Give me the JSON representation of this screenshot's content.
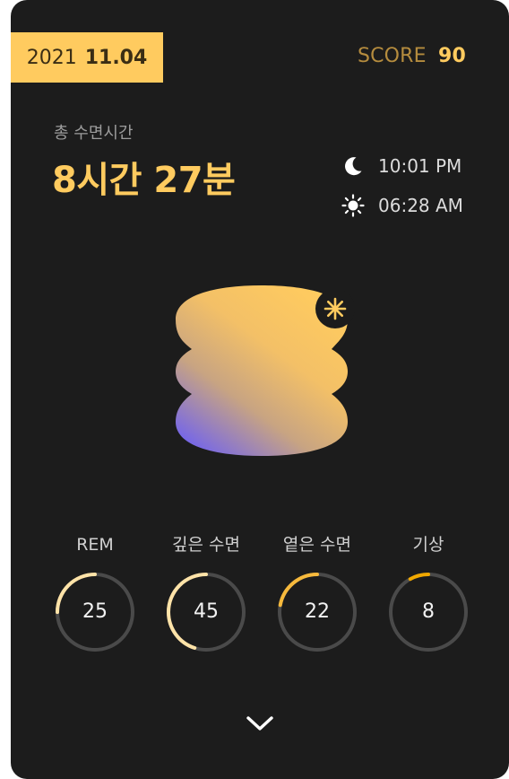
{
  "header": {
    "date_year": "2021",
    "date_month_day": "11.04",
    "score_label": "SCORE",
    "score_value": "90"
  },
  "summary": {
    "total_label": "총 수면시간",
    "total_value": "8시간 27분",
    "bedtime": "10:01 PM",
    "wake_time": "06:28 AM",
    "bedtime_icon": "moon-icon",
    "wake_icon": "sun-icon"
  },
  "illustration": {
    "name": "sleep-blob-illustration",
    "badge_icon": "sparkle-icon",
    "gradient_colors": [
      "#ffcb5f",
      "#c9a47e",
      "#7b6cf0"
    ]
  },
  "stages": [
    {
      "label": "REM",
      "value": "25",
      "percent": 25,
      "color": "#ffe3a8"
    },
    {
      "label": "깊은 수면",
      "value": "45",
      "percent": 45,
      "color": "#ffe3a8"
    },
    {
      "label": "옅은 수면",
      "value": "22",
      "percent": 22,
      "color": "#f6b93c"
    },
    {
      "label": "기상",
      "value": "8",
      "percent": 8,
      "color": "#f0a800"
    }
  ],
  "footer": {
    "expand_icon": "chevron-down-icon"
  },
  "colors": {
    "background": "#1c1c1c",
    "accent": "#ffcb5f",
    "track": "#4a4a4a"
  }
}
